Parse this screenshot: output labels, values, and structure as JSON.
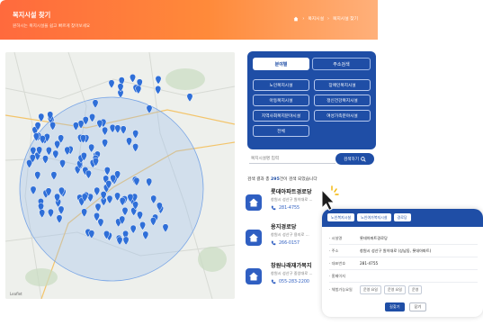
{
  "header": {
    "title": "복지시설 찾기",
    "subtitle": "원하시는 복지시설을 쉽고 빠르게 찾아보세요",
    "breadcrumb": [
      "복지시설",
      "복지시설 찾기"
    ]
  },
  "search_panel": {
    "tabs": [
      {
        "label": "분야별",
        "active": true
      },
      {
        "label": "주소검색",
        "active": false
      }
    ],
    "categories": [
      "노인복지시설",
      "장애인복지시설",
      "아동복지시설",
      "정신건강복지시설",
      "지역사회복지분야시설",
      "여성가족분야시설",
      "전체"
    ]
  },
  "search": {
    "placeholder": "복지시설명 입력",
    "button_label": "검색하기"
  },
  "results": {
    "summary_prefix": "검색 결과 총 ",
    "count": "295",
    "summary_suffix": "건이 검색 되었습니다",
    "items": [
      {
        "name": "롯데아파트경로당",
        "address": "창원시 성산구 원이대로 ...",
        "phone": "281-4755"
      },
      {
        "name": "용지경로당",
        "address": "창원시 성산구 용지로 ...",
        "phone": "266-0157"
      },
      {
        "name": "창원나래재가복지",
        "address": "창원시 성산구 중앙대로 ...",
        "phone": "055-283-2200"
      }
    ]
  },
  "detail_popup": {
    "chips": [
      "노인복지시설",
      "노인여가복지시설",
      "경로당"
    ],
    "rows": [
      {
        "label": "· 시설명",
        "value": "롯데아파트경로당"
      },
      {
        "label": "· 주소",
        "value": "창원시 성산구 원이대로 (상남동, 롯데아파트)"
      },
      {
        "label": "· 대표번호",
        "value": "281-4755"
      },
      {
        "label": "· 홈페이지",
        "value": ""
      },
      {
        "label": "· 체험가능요일",
        "value": ""
      }
    ],
    "day_tags": [
      "운영 요일",
      "운영 요일",
      "운영"
    ],
    "buttons": {
      "primary": "길찾기",
      "secondary": "닫기"
    }
  },
  "map": {
    "attribution": "Leaflet",
    "accent_color": "#2f6fd8"
  },
  "colors": {
    "brand_orange": "#ff6a3d",
    "brand_blue": "#1f4ea6"
  }
}
